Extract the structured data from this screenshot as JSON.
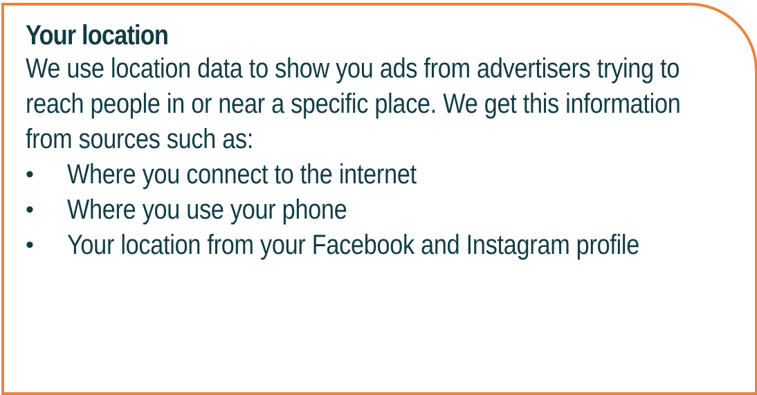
{
  "section": {
    "title": "Your location",
    "description": "We use location data to show you ads from advertisers trying to reach people in or near a specific place. We get this information from sources such as:",
    "bullet_glyph": "•",
    "sources": [
      "Where you connect to the internet",
      "Where you use your phone",
      "Your location from your Facebook and Instagram profile"
    ]
  },
  "colors": {
    "border": "#e8853d",
    "text": "#123c45",
    "background": "#ffffff"
  }
}
